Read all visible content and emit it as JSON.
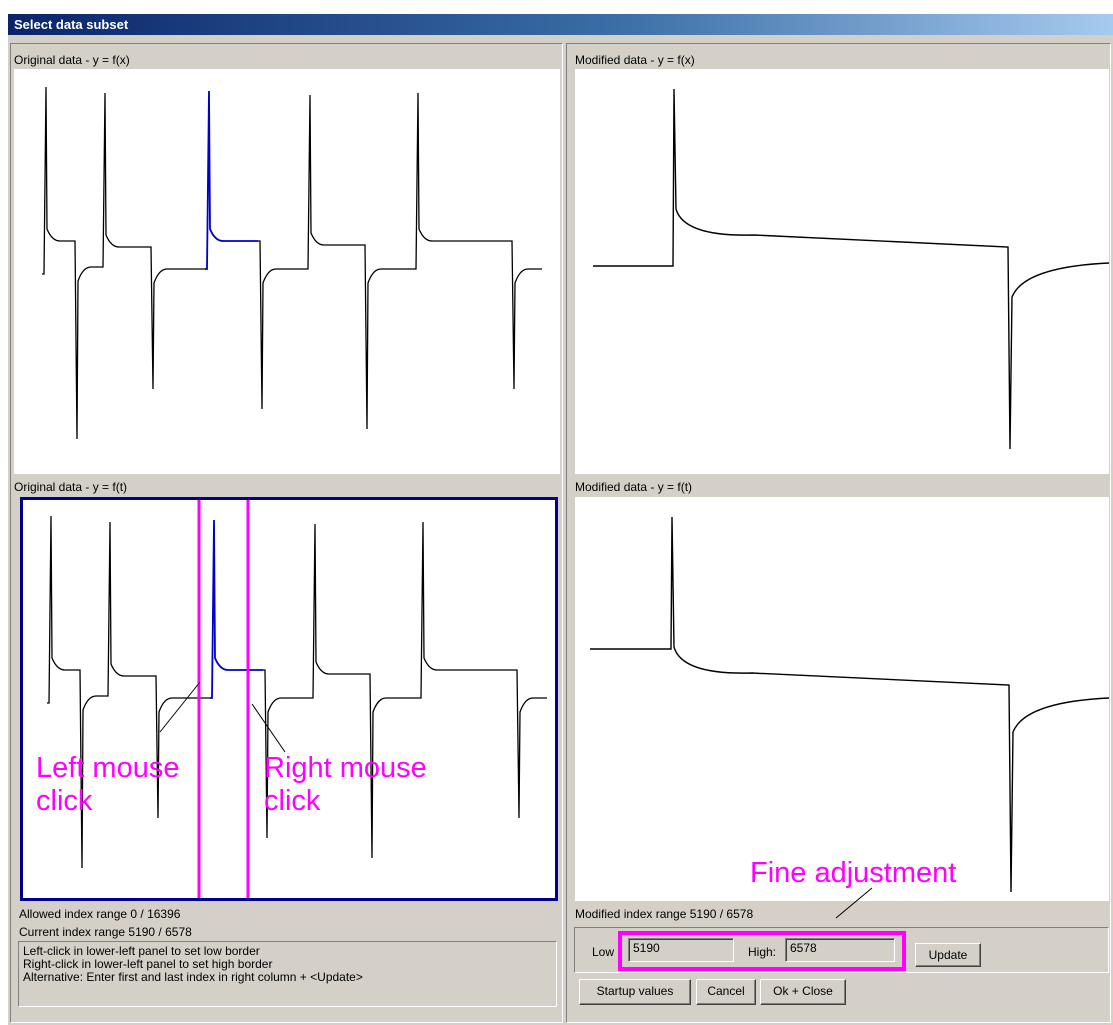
{
  "window": {
    "title": "Select data subset"
  },
  "panels": {
    "top_left_title": "Original data - y = f(x)",
    "bottom_left_title": "Original data - y = f(t)",
    "top_right_title": "Modified data - y = f(x)",
    "bottom_right_title": "Modified data - y = f(t)"
  },
  "info": {
    "allowed_range": "Allowed index range 0 / 16396",
    "current_range": "Current index range 5190 / 6578",
    "modified_range": "Modified index range 5190 / 6578"
  },
  "hints": [
    "Left-click in lower-left panel to set low border",
    "Right-click in lower-left panel to set high border",
    "Alternative: Enter first and last index in right column + <Update>"
  ],
  "controls": {
    "low_label": "Low",
    "low_value": "5190",
    "high_label": "High:",
    "high_value": "6578",
    "update_label": "Update",
    "startup_label": "Startup values",
    "cancel_label": "Cancel",
    "ok_label": "Ok + Close"
  },
  "annotations": {
    "left_click_line1": "Left mouse",
    "left_click_line2": "click",
    "right_click_line1": "Right mouse",
    "right_click_line2": "click",
    "fine_adjustment": "Fine adjustment"
  },
  "colors": {
    "trace": "#000000",
    "selected_trace": "#0000cc",
    "selection_border": "#ff00ff",
    "active_panel_border": "#00008b",
    "annotation": "#ff00ff"
  }
}
